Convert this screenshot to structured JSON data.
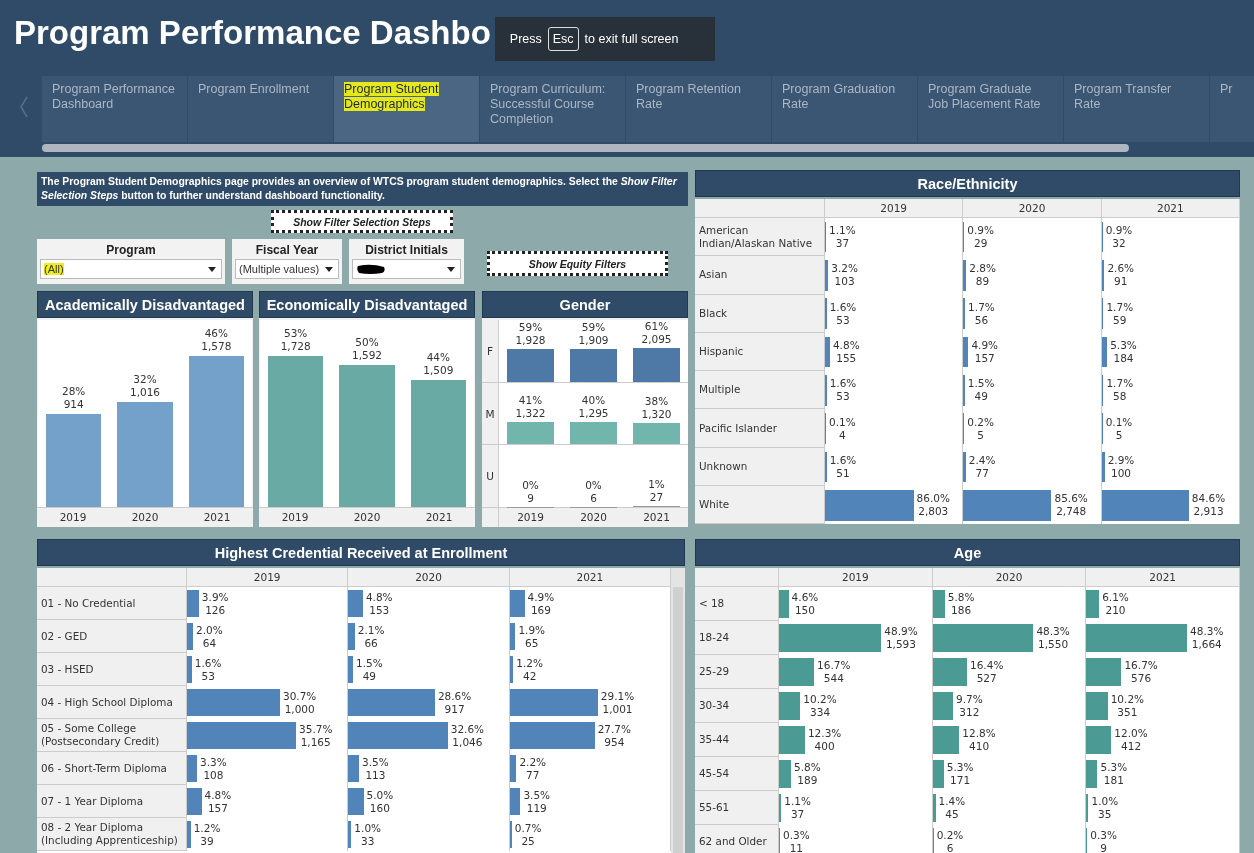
{
  "header": {
    "title": "Program Performance Dashbo",
    "fullscreen_notice": {
      "before": "Press",
      "key": "Esc",
      "after": "to exit full screen"
    }
  },
  "tabs": [
    {
      "label": "Program Performance Dashboard",
      "selected": false
    },
    {
      "label": "Program Enrollment",
      "selected": false
    },
    {
      "label": "Program Student Demographics",
      "selected": true
    },
    {
      "label": "Program Curriculum: Successful Course Completion",
      "selected": false
    },
    {
      "label": "Program Retention Rate",
      "selected": false
    },
    {
      "label": "Program Graduation Rate",
      "selected": false
    },
    {
      "label": "Program Graduate Job Placement Rate",
      "selected": false
    },
    {
      "label": "Program Transfer Rate",
      "selected": false
    },
    {
      "label": "Pr",
      "selected": false
    }
  ],
  "intro": "The Program Student Demographics page provides an overview of WTCS program student demographics. Select the *Show Filter Selection Steps* button to further understand dashboard functionality.",
  "filter_steps_button": "Show Filter Selection Steps",
  "filters": [
    {
      "label": "Program",
      "value": "(All)",
      "highlighted": true,
      "redacted": false
    },
    {
      "label": "Fiscal Year",
      "value": "(Multiple values)",
      "highlighted": false,
      "redacted": false
    },
    {
      "label": "District Initials",
      "highlighted": false,
      "redacted": true
    }
  ],
  "equity_button": "Show Equity Filters",
  "column_charts": [
    {
      "title": "Academically Disadvantaged",
      "bars": [
        {
          "year": "2019",
          "pct": "28%",
          "count": "914"
        },
        {
          "year": "2020",
          "pct": "32%",
          "count": "1,016"
        },
        {
          "year": "2021",
          "pct": "46%",
          "count": "1,578"
        }
      ]
    },
    {
      "title": "Economically Disadvantaged",
      "bars": [
        {
          "year": "2019",
          "pct": "53%",
          "count": "1,728"
        },
        {
          "year": "2020",
          "pct": "50%",
          "count": "1,592"
        },
        {
          "year": "2021",
          "pct": "44%",
          "count": "1,509"
        }
      ]
    }
  ],
  "gender": {
    "title": "Gender",
    "years": [
      "2019",
      "2020",
      "2021"
    ],
    "rows": [
      {
        "label": "F",
        "color": "#4e79a7",
        "cells": [
          {
            "pct": "59%",
            "count": "1,928"
          },
          {
            "pct": "59%",
            "count": "1,909"
          },
          {
            "pct": "61%",
            "count": "2,095"
          }
        ]
      },
      {
        "label": "M",
        "color": "#72b5ad",
        "cells": [
          {
            "pct": "41%",
            "count": "1,322"
          },
          {
            "pct": "40%",
            "count": "1,295"
          },
          {
            "pct": "38%",
            "count": "1,320"
          }
        ]
      },
      {
        "label": "U",
        "color": "#9c9c9c",
        "cells": [
          {
            "pct": "0%",
            "count": "9"
          },
          {
            "pct": "0%",
            "count": "6"
          },
          {
            "pct": "1%",
            "count": "27"
          }
        ]
      }
    ]
  },
  "race": {
    "title": "Race/Ethnicity",
    "years": [
      "2019",
      "2020",
      "2021"
    ],
    "rows": [
      {
        "label": "American Indian/Alaskan Native",
        "cells": [
          {
            "pct": "1.1%",
            "count": "37",
            "level": 0.008
          },
          {
            "pct": "0.9%",
            "count": "29",
            "level": 0.007
          },
          {
            "pct": "0.9%",
            "count": "32",
            "level": 0.007
          }
        ]
      },
      {
        "label": "Asian",
        "cells": [
          {
            "pct": "3.2%",
            "count": "103",
            "level": 0.024
          },
          {
            "pct": "2.8%",
            "count": "89",
            "level": 0.021
          },
          {
            "pct": "2.6%",
            "count": "91",
            "level": 0.02
          }
        ]
      },
      {
        "label": "Black",
        "cells": [
          {
            "pct": "1.6%",
            "count": "53",
            "level": 0.012
          },
          {
            "pct": "1.7%",
            "count": "56",
            "level": 0.013
          },
          {
            "pct": "1.7%",
            "count": "59",
            "level": 0.013
          }
        ]
      },
      {
        "label": "Hispanic",
        "cells": [
          {
            "pct": "4.8%",
            "count": "155",
            "level": 0.036
          },
          {
            "pct": "4.9%",
            "count": "157",
            "level": 0.037
          },
          {
            "pct": "5.3%",
            "count": "184",
            "level": 0.04
          }
        ]
      },
      {
        "label": "Multiple",
        "cells": [
          {
            "pct": "1.6%",
            "count": "53",
            "level": 0.012
          },
          {
            "pct": "1.5%",
            "count": "49",
            "level": 0.011
          },
          {
            "pct": "1.7%",
            "count": "58",
            "level": 0.013
          }
        ]
      },
      {
        "label": "Pacific Islander",
        "cells": [
          {
            "pct": "0.1%",
            "count": "4",
            "level": 0.001
          },
          {
            "pct": "0.2%",
            "count": "5",
            "level": 0.002
          },
          {
            "pct": "0.1%",
            "count": "5",
            "level": 0.001
          }
        ]
      },
      {
        "label": "Unknown",
        "cells": [
          {
            "pct": "1.6%",
            "count": "51",
            "level": 0.012
          },
          {
            "pct": "2.4%",
            "count": "77",
            "level": 0.018
          },
          {
            "pct": "2.9%",
            "count": "100",
            "level": 0.022
          }
        ]
      },
      {
        "label": "White",
        "cells": [
          {
            "pct": "86.0%",
            "count": "2,803",
            "level": 0.645
          },
          {
            "pct": "85.6%",
            "count": "2,748",
            "level": 0.642
          },
          {
            "pct": "84.6%",
            "count": "2,913",
            "level": 0.635
          }
        ]
      }
    ]
  },
  "credential": {
    "title": "Highest Credential Received at Enrollment",
    "years": [
      "2019",
      "2020",
      "2021"
    ],
    "rows": [
      {
        "label": "01 - No Credential",
        "cells": [
          {
            "pct": "3.9%",
            "count": "126",
            "level": 0.074
          },
          {
            "pct": "4.8%",
            "count": "153",
            "level": 0.091
          },
          {
            "pct": "4.9%",
            "count": "169",
            "level": 0.093
          }
        ]
      },
      {
        "label": "02 - GED",
        "cells": [
          {
            "pct": "2.0%",
            "count": "64",
            "level": 0.038
          },
          {
            "pct": "2.1%",
            "count": "66",
            "level": 0.04
          },
          {
            "pct": "1.9%",
            "count": "65",
            "level": 0.036
          }
        ]
      },
      {
        "label": "03 - HSED",
        "cells": [
          {
            "pct": "1.6%",
            "count": "53",
            "level": 0.03
          },
          {
            "pct": "1.5%",
            "count": "49",
            "level": 0.029
          },
          {
            "pct": "1.2%",
            "count": "42",
            "level": 0.023
          }
        ]
      },
      {
        "label": "04 - High School Diploma",
        "cells": [
          {
            "pct": "30.7%",
            "count": "1,000",
            "level": 0.58
          },
          {
            "pct": "28.6%",
            "count": "917",
            "level": 0.54
          },
          {
            "pct": "29.1%",
            "count": "1,001",
            "level": 0.55
          }
        ]
      },
      {
        "label": "05 - Some College (Postsecondary Credit)",
        "cells": [
          {
            "pct": "35.7%",
            "count": "1,165",
            "level": 0.68
          },
          {
            "pct": "32.6%",
            "count": "1,046",
            "level": 0.62
          },
          {
            "pct": "27.7%",
            "count": "954",
            "level": 0.53
          }
        ]
      },
      {
        "label": "06 - Short-Term Diploma",
        "cells": [
          {
            "pct": "3.3%",
            "count": "108",
            "level": 0.063
          },
          {
            "pct": "3.5%",
            "count": "113",
            "level": 0.067
          },
          {
            "pct": "2.2%",
            "count": "77",
            "level": 0.042
          }
        ]
      },
      {
        "label": "07 - 1 Year Diploma",
        "cells": [
          {
            "pct": "4.8%",
            "count": "157",
            "level": 0.091
          },
          {
            "pct": "5.0%",
            "count": "160",
            "level": 0.095
          },
          {
            "pct": "3.5%",
            "count": "119",
            "level": 0.067
          }
        ]
      },
      {
        "label": "08 - 2 Year Diploma (Including Apprenticeship)",
        "cells": [
          {
            "pct": "1.2%",
            "count": "39",
            "level": 0.023
          },
          {
            "pct": "1.0%",
            "count": "33",
            "level": 0.019
          },
          {
            "pct": "0.7%",
            "count": "25",
            "level": 0.013
          }
        ]
      }
    ]
  },
  "age": {
    "title": "Age",
    "years": [
      "2019",
      "2020",
      "2021"
    ],
    "rows": [
      {
        "label": "< 18",
        "cells": [
          {
            "pct": "4.6%",
            "count": "150",
            "level": 0.063
          },
          {
            "pct": "5.8%",
            "count": "186",
            "level": 0.079
          },
          {
            "pct": "6.1%",
            "count": "210",
            "level": 0.084
          }
        ]
      },
      {
        "label": "18-24",
        "cells": [
          {
            "pct": "48.9%",
            "count": "1,593",
            "level": 0.67
          },
          {
            "pct": "48.3%",
            "count": "1,550",
            "level": 0.66
          },
          {
            "pct": "48.3%",
            "count": "1,664",
            "level": 0.66
          }
        ]
      },
      {
        "label": "25-29",
        "cells": [
          {
            "pct": "16.7%",
            "count": "544",
            "level": 0.23
          },
          {
            "pct": "16.4%",
            "count": "527",
            "level": 0.225
          },
          {
            "pct": "16.7%",
            "count": "576",
            "level": 0.23
          }
        ]
      },
      {
        "label": "30-34",
        "cells": [
          {
            "pct": "10.2%",
            "count": "334",
            "level": 0.14
          },
          {
            "pct": "9.7%",
            "count": "312",
            "level": 0.133
          },
          {
            "pct": "10.2%",
            "count": "351",
            "level": 0.14
          }
        ]
      },
      {
        "label": "35-44",
        "cells": [
          {
            "pct": "12.3%",
            "count": "400",
            "level": 0.17
          },
          {
            "pct": "12.8%",
            "count": "410",
            "level": 0.175
          },
          {
            "pct": "12.0%",
            "count": "412",
            "level": 0.164
          }
        ]
      },
      {
        "label": "45-54",
        "cells": [
          {
            "pct": "5.8%",
            "count": "189",
            "level": 0.079
          },
          {
            "pct": "5.3%",
            "count": "171",
            "level": 0.073
          },
          {
            "pct": "5.3%",
            "count": "181",
            "level": 0.073
          }
        ]
      },
      {
        "label": "55-61",
        "cells": [
          {
            "pct": "1.1%",
            "count": "37",
            "level": 0.015
          },
          {
            "pct": "1.4%",
            "count": "45",
            "level": 0.019
          },
          {
            "pct": "1.0%",
            "count": "35",
            "level": 0.014
          }
        ]
      },
      {
        "label": "62 and Older",
        "cells": [
          {
            "pct": "0.3%",
            "count": "11",
            "level": 0.004
          },
          {
            "pct": "0.2%",
            "count": "6",
            "level": 0.003
          },
          {
            "pct": "0.3%",
            "count": "9",
            "level": 0.004
          }
        ]
      }
    ]
  }
}
